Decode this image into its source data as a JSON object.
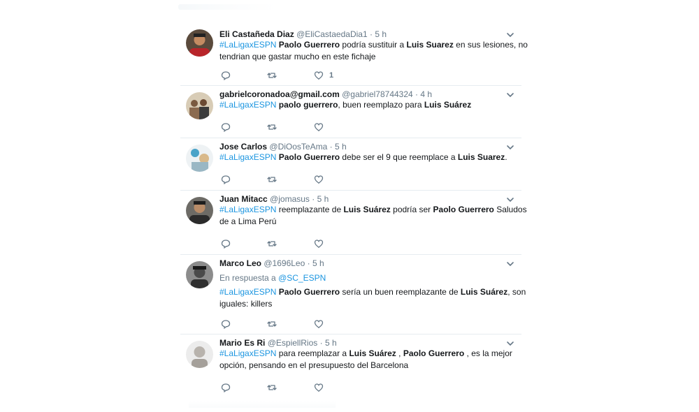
{
  "colors": {
    "link": "#1b95e0",
    "muted": "#657786",
    "divider": "#e6ecf0"
  },
  "icons": {
    "reply": "reply-icon",
    "retweet": "retweet-icon",
    "like": "heart-icon",
    "menu": "chevron-down-icon"
  },
  "tweets": [
    {
      "name": "Eli Castañeda Diaz",
      "handle": "@EliCastaedaDia1",
      "sep": "·",
      "time": "5 h",
      "hashtag": "#LaLigaxESPN",
      "l1a": "Paolo Guerrero",
      "l1b": " podría sustituir a ",
      "l1c": "Luis Suarez",
      "l1d": " en sus lesiones, no",
      "l2": "tendrian que gastar mucho en este fichaje",
      "likes": "1"
    },
    {
      "name": "gabrielcoronadoa@gmail.com",
      "handle": "@gabriel78744324",
      "sep": "·",
      "time": "4 h",
      "hashtag": "#LaLigaxESPN",
      "l1a": "paolo guerrero",
      "l1b": ", buen reemplazo para ",
      "l1c": "Luis Suárez"
    },
    {
      "name": "Jose Carlos",
      "handle": "@DiOosTeAma",
      "sep": "·",
      "time": "5 h",
      "hashtag": "#LaLigaxESPN",
      "l1a": "Paolo Guerrero",
      "l1b": " debe ser el 9 que reemplace a ",
      "l1c": "Luis Suarez",
      "l1d": "."
    },
    {
      "name": "Juan Mitacc",
      "handle": "@jomasus",
      "sep": "·",
      "time": "5 h",
      "hashtag": "#LaLigaxESPN",
      "l1a": " reemplazante de ",
      "l1b": "Luis Suárez",
      "l1c": " podría ser ",
      "l1d": "Paolo Guerrero",
      "l1e": " Saludos",
      "l2": "de a Lima Perú"
    },
    {
      "name": "Marco Leo",
      "handle": "@1696Leo",
      "sep": "·",
      "time": "5 h",
      "reply_prefix": "En respuesta a ",
      "reply_to": "@SC_ESPN",
      "hashtag": "#LaLigaxESPN",
      "l1a": "Paolo Guerrero",
      "l1b": " sería un buen reemplazante de ",
      "l1c": "Luis Suárez",
      "l1d": ", son",
      "l2": "iguales: killers"
    },
    {
      "name": "Mario Es Ri",
      "handle": "@EspiellRios",
      "sep": "·",
      "time": "5 h",
      "hashtag": "#LaLigaxESPN",
      "l1a": " para reemplazar a ",
      "l1b": "Luis Suárez",
      "l1c": " , ",
      "l1d": "Paolo Guerrero",
      "l1e": " , es la mejor",
      "l2": "opción, pensando en el presupuesto del Barcelona"
    }
  ]
}
